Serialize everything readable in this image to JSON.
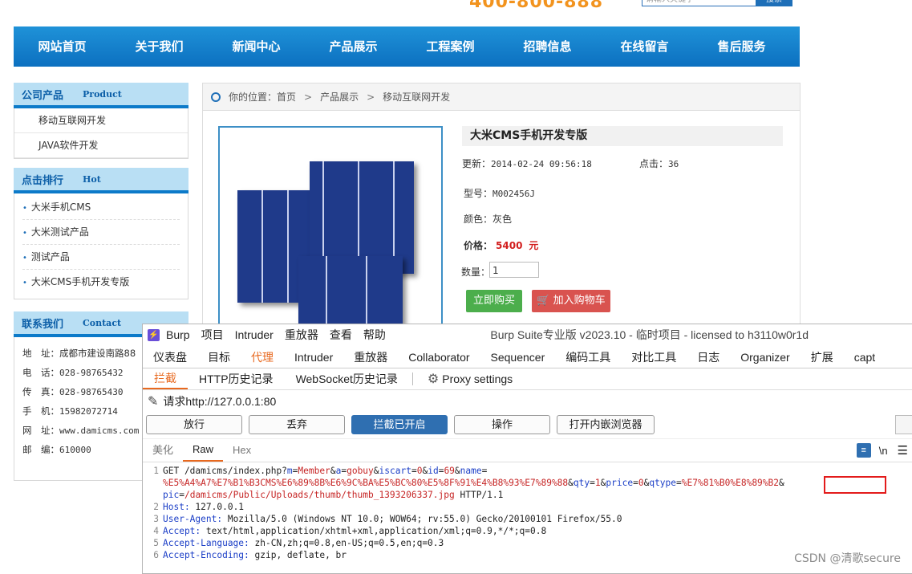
{
  "site": {
    "phone": "400-800-888",
    "search_placeholder": "请输入关键字",
    "search_button": "搜索",
    "nav": [
      "网站首页",
      "关于我们",
      "新闻中心",
      "产品展示",
      "工程案例",
      "招聘信息",
      "在线留言",
      "售后服务"
    ],
    "products_box": {
      "title": "公司产品",
      "subtitle": "Product",
      "items": [
        "移动互联网开发",
        "JAVA软件开发"
      ]
    },
    "rank_box": {
      "title": "点击排行",
      "subtitle": "Hot",
      "items": [
        "大米手机CMS",
        "大米测试产品",
        "测试产品",
        "大米CMS手机开发专版"
      ]
    },
    "contact_box": {
      "title": "联系我们",
      "subtitle": "Contact",
      "rows": [
        {
          "label": "地　址：",
          "value": "成都市建设南路88"
        },
        {
          "label": "电　话：",
          "value": "028-98765432"
        },
        {
          "label": "传　真：",
          "value": "028-98765430"
        },
        {
          "label": "手　机：",
          "value": "15982072714"
        },
        {
          "label": "网　址：",
          "value": "www.damicms.com"
        },
        {
          "label": "邮　编：",
          "value": "610000"
        }
      ]
    },
    "breadcrumb": {
      "prefix": "你的位置：",
      "items": [
        "首页",
        "产品展示",
        "移动互联网开发"
      ],
      "separator": ">"
    },
    "product": {
      "title": "大米CMS手机开发专版",
      "updated_label": "更新：",
      "updated_value": "2014-02-24 09:56:18",
      "clicks_label": "点击：",
      "clicks_value": "36",
      "model_label": "型号：",
      "model_value": "M002456J",
      "color_label": "颜色：",
      "color_value": "灰色",
      "price_label": "价格：",
      "price_value": "5400",
      "price_unit": "元",
      "qty_label": "数量：",
      "qty_value": "1",
      "buy_button": "立即购买",
      "cart_button": "加入购物车",
      "cart_icon": "cart-icon"
    }
  },
  "burp": {
    "title": "Burp Suite专业版  v2023.10 - 临时项目 - licensed to h3110w0r1d",
    "menu": [
      "Burp",
      "项目",
      "Intruder",
      "重放器",
      "查看",
      "帮助"
    ],
    "main_tabs": [
      "仪表盘",
      "目标",
      "代理",
      "Intruder",
      "重放器",
      "Collaborator",
      "Sequencer",
      "编码工具",
      "对比工具",
      "日志",
      "Organizer",
      "扩展",
      "capt"
    ],
    "active_main_tab": "代理",
    "sub_tabs": [
      "拦截",
      "HTTP历史记录",
      "WebSocket历史记录"
    ],
    "proxy_settings": "Proxy settings",
    "request_label": "请求http://127.0.0.1:80",
    "buttons": {
      "forward": "放行",
      "drop": "丢弃",
      "intercept": "拦截已开启",
      "action": "操作",
      "browser": "打开内嵌浏览器"
    },
    "view_tabs": [
      "美化",
      "Raw",
      "Hex"
    ],
    "newline_label": "\\n",
    "request_lines": [
      {
        "n": "1",
        "segments": [
          {
            "t": "GET /damicms/index.php?",
            "c": "tx"
          },
          {
            "t": "m",
            "c": "k"
          },
          {
            "t": "=",
            "c": "tx"
          },
          {
            "t": "Member",
            "c": "v"
          },
          {
            "t": "&",
            "c": "tx"
          },
          {
            "t": "a",
            "c": "k"
          },
          {
            "t": "=",
            "c": "tx"
          },
          {
            "t": "gobuy",
            "c": "v"
          },
          {
            "t": "&",
            "c": "tx"
          },
          {
            "t": "iscart",
            "c": "k"
          },
          {
            "t": "=",
            "c": "tx"
          },
          {
            "t": "0",
            "c": "v"
          },
          {
            "t": "&",
            "c": "tx"
          },
          {
            "t": "id",
            "c": "k"
          },
          {
            "t": "=",
            "c": "tx"
          },
          {
            "t": "69",
            "c": "v"
          },
          {
            "t": "&",
            "c": "tx"
          },
          {
            "t": "name",
            "c": "k"
          },
          {
            "t": "=",
            "c": "tx"
          }
        ]
      },
      {
        "n": "",
        "segments": [
          {
            "t": "%E5%A4%A7%E7%B1%B3CMS%E6%89%8B%E6%9C%BA%E5%BC%80%E5%8F%91%E4%B8%93%E7%89%88",
            "c": "v"
          },
          {
            "t": "&",
            "c": "tx"
          },
          {
            "t": "qty",
            "c": "k"
          },
          {
            "t": "=",
            "c": "tx"
          },
          {
            "t": "1",
            "c": "v"
          },
          {
            "t": "&",
            "c": "tx"
          },
          {
            "t": "price",
            "c": "k"
          },
          {
            "t": "=",
            "c": "tx"
          },
          {
            "t": "0",
            "c": "v"
          },
          {
            "t": "&",
            "c": "tx"
          },
          {
            "t": "qtype",
            "c": "k"
          },
          {
            "t": "=",
            "c": "tx"
          },
          {
            "t": "%E7%81%B0%E8%89%B2",
            "c": "v"
          },
          {
            "t": "&",
            "c": "tx"
          }
        ]
      },
      {
        "n": "",
        "segments": [
          {
            "t": "pic",
            "c": "k"
          },
          {
            "t": "=",
            "c": "tx"
          },
          {
            "t": "/damicms/Public/Uploads/thumb/thumb_1393206337.jpg",
            "c": "v"
          },
          {
            "t": " HTTP/1.1",
            "c": "tx"
          }
        ]
      },
      {
        "n": "2",
        "segments": [
          {
            "t": "Host:",
            "c": "k"
          },
          {
            "t": " 127.0.0.1",
            "c": "tx"
          }
        ]
      },
      {
        "n": "3",
        "segments": [
          {
            "t": "User-Agent:",
            "c": "k"
          },
          {
            "t": " Mozilla/5.0 (Windows NT 10.0; WOW64; rv:55.0) Gecko/20100101 Firefox/55.0",
            "c": "tx"
          }
        ]
      },
      {
        "n": "4",
        "segments": [
          {
            "t": "Accept:",
            "c": "k"
          },
          {
            "t": " text/html,application/xhtml+xml,application/xml;q=0.9,*/*;q=0.8",
            "c": "tx"
          }
        ]
      },
      {
        "n": "5",
        "segments": [
          {
            "t": "Accept-Language:",
            "c": "k"
          },
          {
            "t": " zh-CN,zh;q=0.8,en-US;q=0.5,en;q=0.3",
            "c": "tx"
          }
        ]
      },
      {
        "n": "6",
        "segments": [
          {
            "t": "Accept-Encoding:",
            "c": "k"
          },
          {
            "t": " gzip, deflate, br",
            "c": "tx"
          }
        ]
      }
    ],
    "icons": {
      "logo": "burp-logo-icon",
      "pencil": "pencil-icon",
      "gear": "gear-icon",
      "wrap": "wrap-icon",
      "menu": "menu-icon"
    },
    "highlight_color": "#e31b1b",
    "accent_color": "#e8691f"
  },
  "watermark": "CSDN @清歌secure"
}
